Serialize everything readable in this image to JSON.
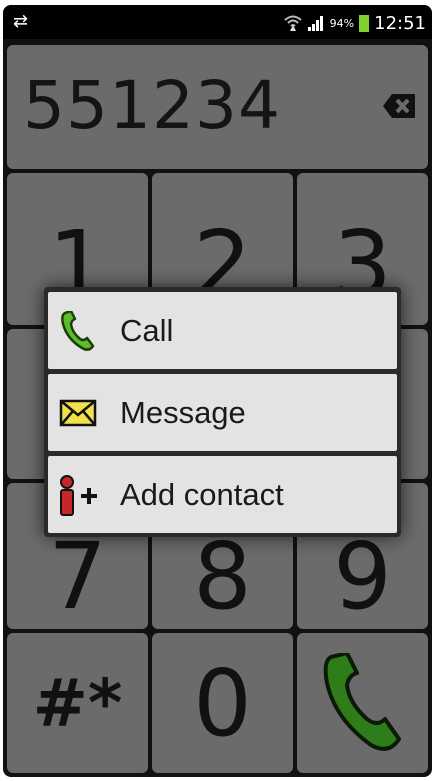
{
  "status_bar": {
    "sync_icon": "sync-icon",
    "wifi_icon": "wifi-icon",
    "signal_icon": "signal-icon",
    "battery_percent": "94%",
    "battery_level": 0.94,
    "time": "12:51"
  },
  "display": {
    "number": "551234",
    "backspace_icon": "backspace-icon"
  },
  "keypad": {
    "keys": [
      "1",
      "2",
      "3",
      "",
      "",
      "",
      "7",
      "8",
      "9",
      "#*",
      "0"
    ],
    "call_icon": "phone-icon",
    "call_color": "#2e7d1a"
  },
  "popup": {
    "items": [
      {
        "label": "Call",
        "icon": "phone-icon"
      },
      {
        "label": "Message",
        "icon": "envelope-icon"
      },
      {
        "label": "Add contact",
        "icon": "add-contact-icon"
      }
    ]
  },
  "colors": {
    "key_bg": "#6b6b6b",
    "popup_bg": "#e3e3e3",
    "envelope": "#f0e14a",
    "person": "#c62828",
    "phone_green": "#5bbd2b"
  }
}
